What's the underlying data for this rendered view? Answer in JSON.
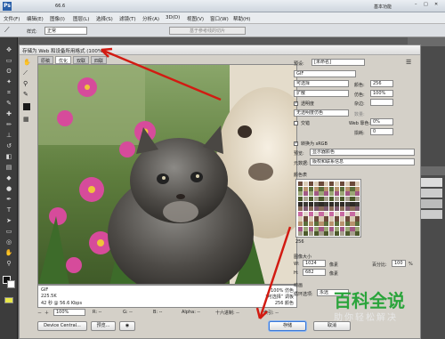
{
  "app": {
    "menus": [
      "文件(F)",
      "编辑(E)",
      "图像(I)",
      "图层(L)",
      "选择(S)",
      "滤镜(T)",
      "分析(A)",
      "3D(D)",
      "视图(V)",
      "窗口(W)",
      "帮助(H)"
    ],
    "workspace_label": "基本功能",
    "zoom_top": "66.6",
    "options_style_label": "样式:",
    "options_style_value": "正常",
    "options_adjust_button": "基于参考线的切片"
  },
  "dialog": {
    "title": "存储为 Web 和设备所用格式 (100%)",
    "tabs": [
      "原稿",
      "优化",
      "双联",
      "四联"
    ],
    "active_tab": "优化",
    "info_left": [
      "GIF",
      "225.5K",
      "42 秒 @ 56.6 Kbps"
    ],
    "info_right": [
      "100% 仿色",
      "“可选择” 调板",
      "256 颜色"
    ],
    "zoom_value": "100%",
    "status_r": "R: --",
    "status_g": "G: --",
    "status_b": "B: --",
    "status_alpha": "Alpha: --",
    "status_hex": "十六进制: --",
    "status_index": "索引: --",
    "buttons": {
      "device_central": "Device Central...",
      "preview": "预览...",
      "save": "存储",
      "cancel": "取消"
    },
    "settings": {
      "preset_label": "预设:",
      "preset_value": "[未命名]",
      "format_value": "GIF",
      "reduction_value": "可选择",
      "colors_label": "颜色:",
      "colors_value": "256",
      "dither_value": "扩散",
      "dither_amount_label": "仿色:",
      "dither_amount_value": "100%",
      "transparency_label": "透明度",
      "matte_label": "杂边:",
      "no_transparency_dither": "无透明度仿色",
      "amount_label": "数量:",
      "interlace_label": "交错",
      "web_snap_label": "Web 靠色:",
      "web_snap_value": "0%",
      "lossy_label": "损耗:",
      "lossy_value": "0",
      "convert_srgb": "转换为 sRGB",
      "preview_label": "预览:",
      "preview_value": "显示器颜色",
      "metadata_label": "元数据:",
      "metadata_value": "版权和联系信息",
      "color_table_label": "颜色表",
      "color_count": "256",
      "image_size_label": "图像大小",
      "width_label": "W:",
      "width_value": "1024",
      "height_label": "H:",
      "height_value": "682",
      "unit_label": "像素",
      "percent_label": "百分比:",
      "percent_value": "100",
      "percent_unit": "%",
      "animation_label": "动画",
      "loop_label": "循环选项:",
      "loop_value": "永远"
    }
  },
  "watermark": {
    "main": "百科全说",
    "sub": "助你轻松解决"
  },
  "colors": {
    "arrow": "#d21b12",
    "watermark_green": "#2aa43b",
    "save_highlight": "#3a78d8"
  }
}
